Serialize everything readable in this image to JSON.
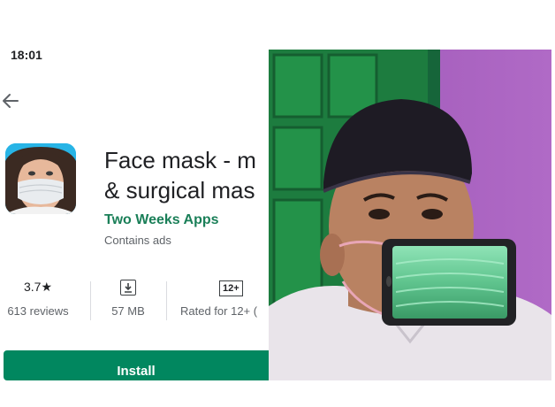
{
  "status_bar": {
    "time": "18:01"
  },
  "app": {
    "title_line1": "Face mask - m",
    "title_line2": "& surgical mas",
    "developer": "Two Weeks Apps",
    "ads_note": "Contains ads"
  },
  "stats": {
    "rating_value": "3.7★",
    "rating_label": "613 reviews",
    "size_label": "57 MB",
    "age_badge": "12+",
    "age_label": "Rated for 12+ ("
  },
  "install_label": "Install",
  "icons": {
    "back": "back-arrow-icon",
    "download": "download-icon",
    "app_icon": "face-mask-app-icon"
  },
  "colors": {
    "developer_green": "#1a7f58",
    "install_green": "#01875f",
    "wall_purple": "#a45dba",
    "door_green": "#1d8a45",
    "mask_green": "#6fd6a0"
  }
}
